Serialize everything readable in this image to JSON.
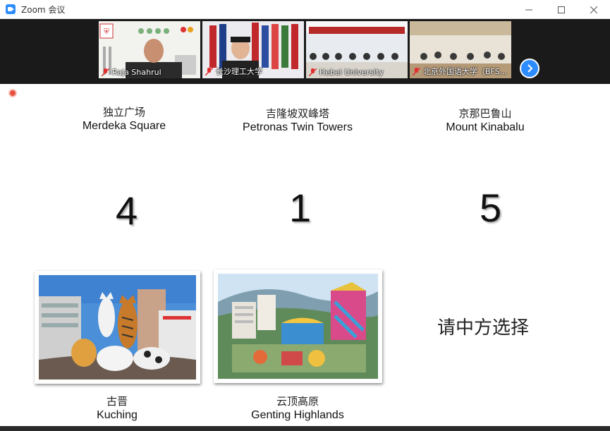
{
  "window": {
    "title": "Zoom 会议"
  },
  "gallery": {
    "participants": [
      {
        "name": "Raja Shahrul"
      },
      {
        "name": "长沙理工大学"
      },
      {
        "name": "Hebei University"
      },
      {
        "name": "北京外国语大学（BFS..."
      }
    ],
    "next_icon": "chevron-right-icon"
  },
  "slide": {
    "options": [
      {
        "zh": "独立广场",
        "en": "Merdeka Square",
        "number": "4"
      },
      {
        "zh": "吉隆坡双峰塔",
        "en": "Petronas Twin Towers",
        "number": "1"
      },
      {
        "zh": "京那巴鲁山",
        "en": "Mount Kinabalu",
        "number": "5"
      }
    ],
    "photos": [
      {
        "zh": "古晋",
        "en": "Kuching"
      },
      {
        "zh": "云顶高原",
        "en": "Genting Highlands"
      }
    ],
    "prompt": "请中方选择"
  },
  "colors": {
    "accent": "#2d8cff",
    "muted_mic": "#e0302e",
    "record": "#e8513e"
  }
}
